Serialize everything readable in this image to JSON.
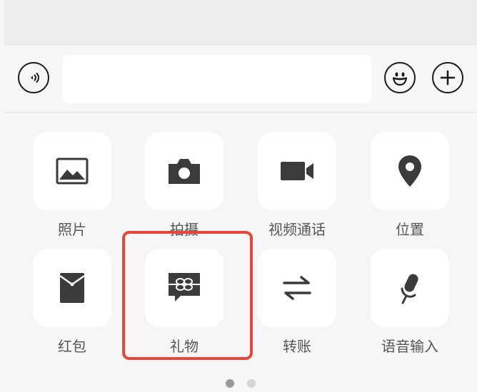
{
  "input_bar": {
    "voice_icon": "voice-input-icon",
    "text_value": "",
    "emoji_icon": "emoji-icon",
    "plus_icon": "plus-icon"
  },
  "panel": {
    "items": [
      {
        "label": "照片",
        "icon": "photo-icon"
      },
      {
        "label": "拍摄",
        "icon": "camera-icon"
      },
      {
        "label": "视频通话",
        "icon": "video-call-icon"
      },
      {
        "label": "位置",
        "icon": "location-icon"
      },
      {
        "label": "红包",
        "icon": "red-packet-icon"
      },
      {
        "label": "礼物",
        "icon": "gift-icon"
      },
      {
        "label": "转账",
        "icon": "transfer-icon"
      },
      {
        "label": "语音输入",
        "icon": "microphone-icon"
      }
    ],
    "highlighted_item": "礼物",
    "highlight_color": "#e8463a"
  },
  "pagination": {
    "pages": 2,
    "current": 1,
    "active_color": "#9a9a9a",
    "inactive_color": "#d6d6d6"
  }
}
